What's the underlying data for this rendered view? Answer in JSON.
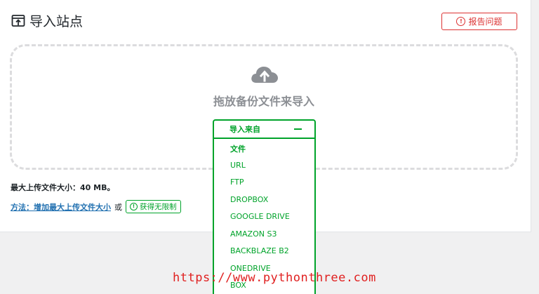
{
  "header": {
    "title": "导入站点",
    "report_label": "报告问题"
  },
  "dropzone": {
    "prompt": "拖放备份文件来导入"
  },
  "import_from": {
    "label": "导入来自",
    "options": [
      "文件",
      "URL",
      "FTP",
      "DROPBOX",
      "GOOGLE DRIVE",
      "AMAZON S3",
      "BACKBLAZE B2",
      "ONEDRIVE",
      "BOX"
    ]
  },
  "limits": {
    "max_upload": "最大上传文件大小：40 MB。",
    "method_link": "方法：增加最大上传文件大小",
    "or_text": "或",
    "unlimited_label": "获得无限制"
  },
  "watermark": "https://www.pythonthree.com",
  "colors": {
    "accent_green": "#00a32a",
    "report_red": "#dc3232",
    "link_blue": "#2271b1"
  }
}
